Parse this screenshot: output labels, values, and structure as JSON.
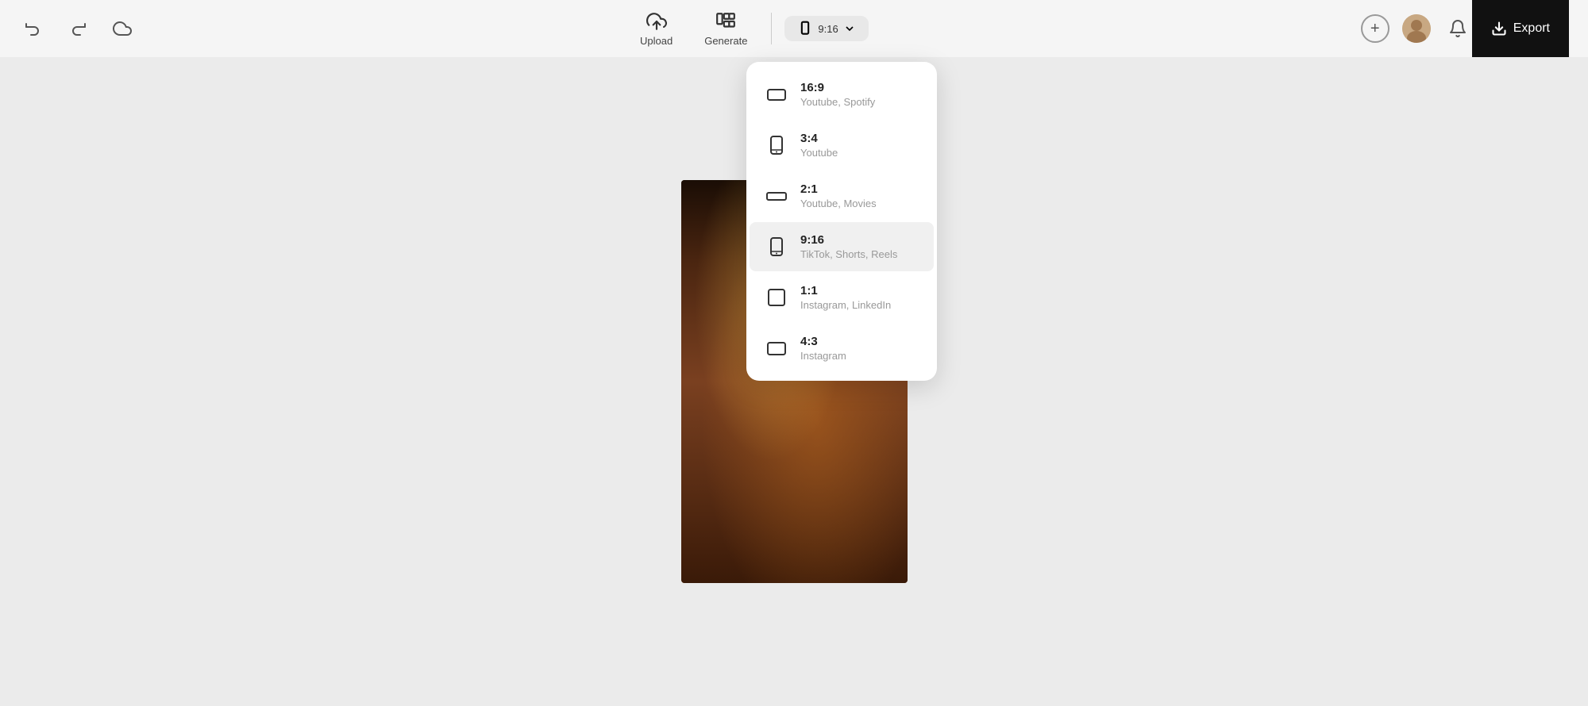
{
  "toolbar": {
    "undo_label": "undo",
    "redo_label": "redo",
    "save_label": "save",
    "upload_label": "Upload",
    "generate_label": "Generate",
    "aspect_ratio_label": "9:16",
    "export_label": "Export",
    "add_label": "+"
  },
  "aspect_dropdown": {
    "items": [
      {
        "id": "16-9",
        "ratio": "16:9",
        "platforms": "Youtube, Spotify",
        "icon": "landscape",
        "active": false
      },
      {
        "id": "3-4",
        "ratio": "3:4",
        "platforms": "Youtube",
        "icon": "portrait",
        "active": false
      },
      {
        "id": "2-1",
        "ratio": "2:1",
        "platforms": "Youtube, Movies",
        "icon": "wide-landscape",
        "active": false
      },
      {
        "id": "9-16",
        "ratio": "9:16",
        "platforms": "TikTok, Shorts, Reels",
        "icon": "mobile-portrait",
        "active": true
      },
      {
        "id": "1-1",
        "ratio": "1:1",
        "platforms": "Instagram, LinkedIn",
        "icon": "square",
        "active": false
      },
      {
        "id": "4-3",
        "ratio": "4:3",
        "platforms": "Instagram",
        "icon": "landscape-small",
        "active": false
      }
    ]
  }
}
